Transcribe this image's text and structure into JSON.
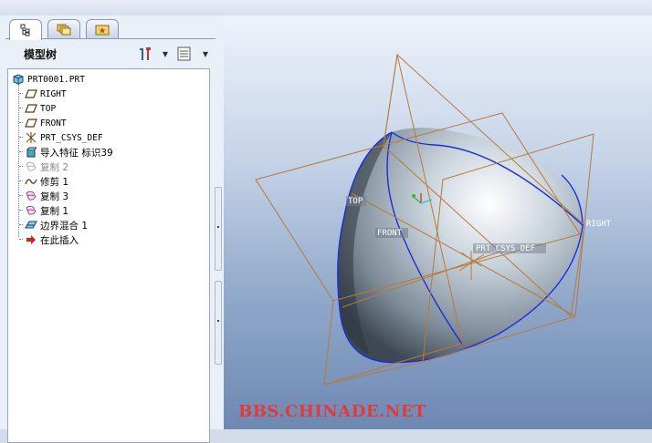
{
  "tree": {
    "title": "模型树",
    "items": [
      {
        "label": "PRT0001.PRT",
        "icon": "part-icon",
        "mono": true
      },
      {
        "label": "RIGHT",
        "icon": "datum-plane-icon",
        "mono": true
      },
      {
        "label": "TOP",
        "icon": "datum-plane-icon",
        "mono": true
      },
      {
        "label": "FRONT",
        "icon": "datum-plane-icon",
        "mono": true
      },
      {
        "label": "PRT_CSYS_DEF",
        "icon": "csys-icon",
        "mono": true
      },
      {
        "label": "导入特征 标识39",
        "icon": "import-feature-icon",
        "mono": false
      },
      {
        "label": "复制 2",
        "icon": "copy-surface-icon",
        "mono": false,
        "dim": true
      },
      {
        "label": "修剪 1",
        "icon": "trim-icon",
        "mono": false
      },
      {
        "label": "复制 3",
        "icon": "copy-surface-icon",
        "mono": false
      },
      {
        "label": "复制 1",
        "icon": "copy-surface-icon",
        "mono": false
      },
      {
        "label": "边界混合 1",
        "icon": "boundary-blend-icon",
        "mono": false
      },
      {
        "label": "在此插入",
        "icon": "insert-here-arrow-icon",
        "mono": false
      }
    ]
  },
  "tabs": [
    {
      "name": "model-tree-tab",
      "icon": "model-tree-icon"
    },
    {
      "name": "folder-browser-tab",
      "icon": "folders-icon"
    },
    {
      "name": "favorites-tab",
      "icon": "favorites-icon"
    }
  ],
  "viewport": {
    "labels": {
      "top": "TOP",
      "front": "FRONT",
      "right": "RIGHT",
      "csys": "PRT_CSYS_DEF"
    },
    "watermark": "BBS.CHINADE.NET"
  },
  "colors": {
    "datum": "#b87a3a",
    "edge": "#1a2fd8",
    "watermark": "#e23a3a"
  }
}
